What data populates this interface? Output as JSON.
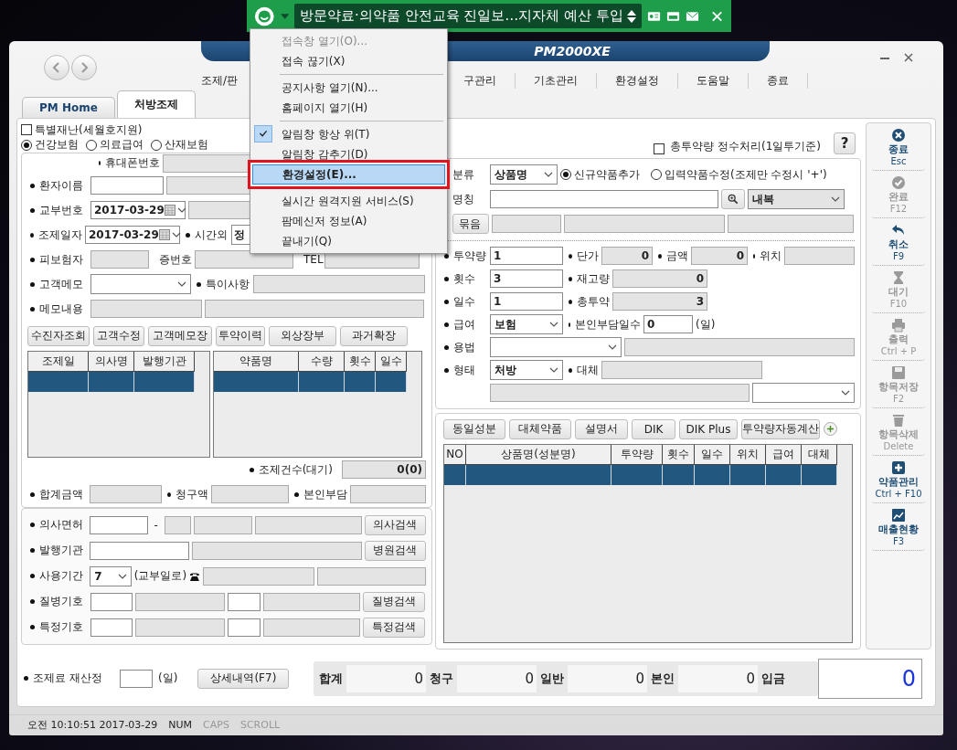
{
  "notifier": {
    "headline": "방문약료·의약품 안전교육 진일보…지자체 예산 투입"
  },
  "menu": [
    {
      "kind": "item",
      "label": "접속창 열기(O)...",
      "disabled": true,
      "checked": false,
      "selected": false
    },
    {
      "kind": "item",
      "label": "접속 끊기(X)",
      "disabled": false,
      "checked": false,
      "selected": false
    },
    {
      "kind": "separator"
    },
    {
      "kind": "item",
      "label": "공지사항 열기(N)...",
      "disabled": false,
      "checked": false,
      "selected": false
    },
    {
      "kind": "item",
      "label": "홈페이지 열기(H)",
      "disabled": false,
      "checked": false,
      "selected": false
    },
    {
      "kind": "separator"
    },
    {
      "kind": "item",
      "label": "알림창 항상 위(T)",
      "disabled": false,
      "checked": true,
      "selected": false
    },
    {
      "kind": "item",
      "label": "알림창 감추기(D)",
      "disabled": false,
      "checked": false,
      "selected": false
    },
    {
      "kind": "item",
      "label": "환경설정(E)...",
      "disabled": false,
      "checked": false,
      "selected": true
    },
    {
      "kind": "separator"
    },
    {
      "kind": "item",
      "label": "실시간 원격지원 서비스(S)",
      "disabled": false,
      "checked": false,
      "selected": false
    },
    {
      "kind": "item",
      "label": "팜메신저 정보(A)",
      "disabled": false,
      "checked": false,
      "selected": false
    },
    {
      "kind": "item",
      "label": "끝내기(Q)",
      "disabled": false,
      "checked": false,
      "selected": false
    }
  ],
  "window": {
    "logo": "PM2000XE"
  },
  "nav": [
    "조제/판",
    "구관리",
    "기초관리",
    "환경설정",
    "도움말",
    "종료"
  ],
  "tabs": [
    {
      "label": "PM Home",
      "selected": false
    },
    {
      "label": "처방조제",
      "selected": true
    }
  ],
  "special_disaster": {
    "label": "특별재난(세월호지원)",
    "checked": false
  },
  "insurance": [
    {
      "label": "건강보험",
      "selected": true
    },
    {
      "label": "의료급여",
      "selected": false
    },
    {
      "label": "산재보험",
      "selected": false
    }
  ],
  "patient": {
    "phone_label": "휴대폰번호",
    "name_label": "환자이름",
    "issue_label": "교부번호",
    "issue_date": "2017-03-29",
    "dispense_label": "조제일자",
    "dispense_date": "2017-03-29",
    "overtime_label": "시간외",
    "overtime_value": "정",
    "insured_label": "피보험자",
    "cert_label": "증번호",
    "tel_label": "TEL",
    "memo_label": "고객메모",
    "note_label": "특이사항",
    "memo_content_label": "메모내용"
  },
  "patient_buttons": [
    "수진자조회",
    "고객수정",
    "고객메모장",
    "투약이력",
    "외상장부",
    "과거확장"
  ],
  "history_table": {
    "columns": [
      "조제일",
      "의사명",
      "발행기관"
    ]
  },
  "drug_history_table": {
    "columns": [
      "약품명",
      "수량",
      "횟수",
      "일수"
    ]
  },
  "waiting": {
    "label": "조제건수(대기)",
    "value": "0(0)"
  },
  "amounts": [
    "합계금액",
    "청구액",
    "본인부담"
  ],
  "prescriber": {
    "license_label": "의사면허",
    "dash": "-",
    "doctor_search": "의사검색",
    "institution_label": "발행기관",
    "hospital_search": "병원검색",
    "period_label": "사용기간",
    "period_value": "7",
    "period_note": "(교부일로)",
    "disease_label": "질병기호",
    "disease_search": "질병검색",
    "special_label": "특정기호",
    "special_search": "특정검색"
  },
  "recalc": {
    "label": "조제료 재산정",
    "unit": "(일)",
    "detail_button": "상세내역(F7)"
  },
  "drug_form": {
    "integer_label": "총투약량 정수처리(1일투기준)",
    "integer_checked": false,
    "help": "?",
    "category_label": "분류",
    "category_value": "상품명",
    "modes": [
      {
        "label": "신규약품추가",
        "selected": true
      },
      {
        "label": "입력약품수정(조제만 수정시 '+')",
        "selected": false
      }
    ],
    "name_label": "명칭",
    "route_value": "내복",
    "bundle_button": "묶음",
    "dose_label": "투약량",
    "dose": "1",
    "price_label": "단가",
    "price": "0",
    "amount_label": "금액",
    "amount": "0",
    "location_label": "위치",
    "times_label": "횟수",
    "times": "3",
    "stock_label": "재고량",
    "stock": "0",
    "days_label": "일수",
    "days": "1",
    "total_label": "총투약",
    "total": "3",
    "benefit_label": "급여",
    "benefit_value": "보험",
    "copay_days_label": "본인부담일수",
    "copay_days": "0",
    "copay_unit": "(일)",
    "usage_label": "용법",
    "form_label": "형태",
    "form_value": "처방",
    "substitute_label": "대체"
  },
  "drug_buttons": [
    "동일성분",
    "대체약품",
    "설명서",
    "DIK",
    "DIK Plus",
    "투약량자동계산"
  ],
  "drug_table": {
    "columns": [
      "NO",
      "상품명(성분명)",
      "투약량",
      "횟수",
      "일수",
      "위치",
      "급여",
      "대체"
    ]
  },
  "totals": [
    {
      "label": "합계",
      "value": "0"
    },
    {
      "label": "청구",
      "value": "0"
    },
    {
      "label": "일반",
      "value": "0"
    },
    {
      "label": "본인",
      "value": "0"
    }
  ],
  "deposit": {
    "label": "입금",
    "value": "0"
  },
  "toolbar": [
    {
      "kind": "close",
      "label": "종료",
      "key": "Esc",
      "disabled": false
    },
    {
      "kind": "done",
      "label": "완료",
      "key": "F12",
      "disabled": true
    },
    {
      "kind": "undo",
      "label": "취소",
      "key": "F9",
      "disabled": false
    },
    {
      "kind": "wait",
      "label": "대기",
      "key": "F10",
      "disabled": true
    },
    {
      "kind": "print",
      "label": "출력",
      "key": "Ctrl + P",
      "disabled": true
    },
    {
      "kind": "save",
      "label": "항목저장",
      "key": "F2",
      "disabled": true
    },
    {
      "kind": "delete",
      "label": "항목삭제",
      "key": "Delete",
      "disabled": true
    },
    {
      "kind": "add",
      "label": "약품관리",
      "key": "Ctrl + F10",
      "disabled": false
    },
    {
      "kind": "chart",
      "label": "매출현황",
      "key": "F3",
      "disabled": false
    }
  ],
  "status_bar": [
    {
      "text": "오전 10:10:51 2017-03-29",
      "on": true
    },
    {
      "text": "NUM",
      "on": true
    },
    {
      "text": "CAPS",
      "on": false
    },
    {
      "text": "SCROLL",
      "on": false
    }
  ]
}
